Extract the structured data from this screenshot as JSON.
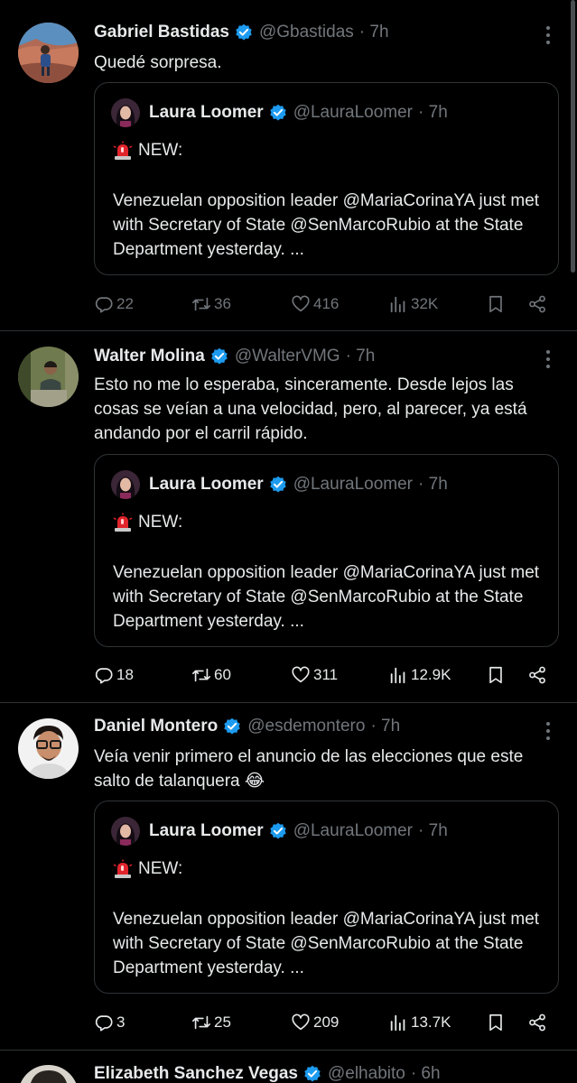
{
  "tweets": [
    {
      "name": "Gabriel Bastidas",
      "handle": "@Gbastidas",
      "time": "· 7h",
      "text": "Quedé sorpresa.",
      "quote": {
        "name": "Laura Loomer",
        "handle": "@LauraLoomer",
        "time": "· 7h",
        "new_label": "NEW:",
        "body": "Venezuelan opposition leader @MariaCorinaYA just met with Secretary of State @SenMarcoRubio at the State Department yesterday. ..."
      },
      "replies": "22",
      "retweets": "36",
      "likes": "416",
      "views": "32K"
    },
    {
      "name": "Walter Molina",
      "handle": "@WalterVMG",
      "time": "· 7h",
      "text": "Esto no me lo esperaba, sinceramente. Desde lejos las cosas se veían a una velocidad, pero, al parecer, ya está andando por el carril rápido.",
      "quote": {
        "name": "Laura Loomer",
        "handle": "@LauraLoomer",
        "time": "· 7h",
        "new_label": "NEW:",
        "body": "Venezuelan opposition leader @MariaCorinaYA just met with Secretary of State @SenMarcoRubio at the State Department yesterday. ..."
      },
      "replies": "18",
      "retweets": "60",
      "likes": "311",
      "views": "12.9K"
    },
    {
      "name": "Daniel Montero",
      "handle": "@esdemontero",
      "time": "· 7h",
      "text": "Veía venir primero el anuncio de las elecciones que este salto de talanquera 😂",
      "quote": {
        "name": "Laura Loomer",
        "handle": "@LauraLoomer",
        "time": "· 7h",
        "new_label": "NEW:",
        "body": "Venezuelan opposition leader @MariaCorinaYA just met with Secretary of State @SenMarcoRubio at the State Department yesterday. ..."
      },
      "replies": "3",
      "retweets": "25",
      "likes": "209",
      "views": "13.7K"
    },
    {
      "name": "Elizabeth Sanchez Vegas",
      "handle": "@elhabito",
      "time": "· 6h"
    }
  ],
  "icons": {
    "verified": "verified-badge-icon",
    "more": "more-dots-icon",
    "reply": "reply-bubble-icon",
    "retweet": "retweet-icon",
    "like": "heart-icon",
    "views": "bar-chart-icon",
    "bookmark": "bookmark-icon",
    "share": "share-icon",
    "siren": "police-light-icon"
  },
  "colors": {
    "background": "#000000",
    "text": "#e7e9ea",
    "secondary": "#71767b",
    "border": "#2f3336",
    "verified": "#1d9bf0"
  }
}
